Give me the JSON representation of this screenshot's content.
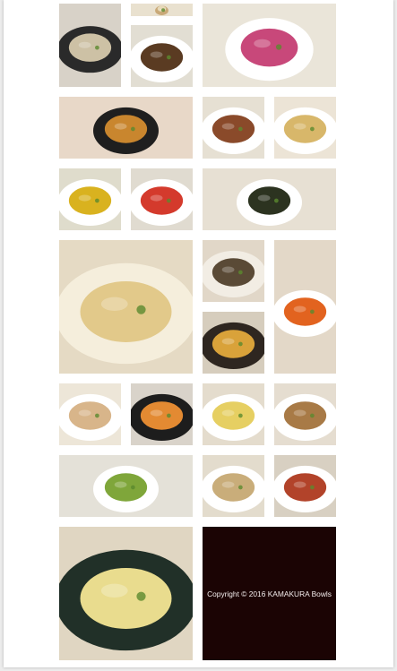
{
  "page": {
    "background": "#ececec",
    "panel": "#ffffff"
  },
  "gallery": {
    "tiles": [
      {
        "name": "potato-salad-photo",
        "bg": "#d8d2c8",
        "plate": "#2a2a2a",
        "food": "#cdc1a5"
      },
      {
        "name": "steamer-basket-photo",
        "bg": "#e9e1cf",
        "plate": "#c9a978",
        "food": "#e7d9b8"
      },
      {
        "name": "croquettes-beet-photo",
        "bg": "#eae5d9",
        "plate": "#ffffff",
        "food": "#c8487a"
      },
      {
        "name": "dipping-sauce-bowl-photo",
        "bg": "#e2ded3",
        "plate": "#ffffff",
        "food": "#5a3b22"
      },
      {
        "name": "mapo-tofu-photo",
        "bg": "#e8d8c8",
        "plate": "#1f1f1f",
        "food": "#c9862e"
      },
      {
        "name": "stuffed-pepper-photo",
        "bg": "#e6e0d3",
        "plate": "#ffffff",
        "food": "#8a4a2a"
      },
      {
        "name": "clear-soup-photo",
        "bg": "#ece4d6",
        "plate": "#ffffff",
        "food": "#d8b76a"
      },
      {
        "name": "three-sauces-photo",
        "bg": "#dfdccc",
        "plate": "#ffffff",
        "food": "#d9b21f"
      },
      {
        "name": "tomato-salad-photo",
        "bg": "#e0dbd0",
        "plate": "#ffffff",
        "food": "#d43a2c"
      },
      {
        "name": "hijiki-seaweed-photo",
        "bg": "#e7e0d3",
        "plate": "#ffffff",
        "food": "#2c3320"
      },
      {
        "name": "tofu-skin-roll-photo",
        "bg": "#e5dac4",
        "plate": "#f5eedc",
        "food": "#e2c98a"
      },
      {
        "name": "grilled-eggplant-photo",
        "bg": "#e1d7c8",
        "plate": "#f2ede4",
        "food": "#5a4a36"
      },
      {
        "name": "carrot-salad-photo",
        "bg": "#e3d8c8",
        "plate": "#ffffff",
        "food": "#e2631f"
      },
      {
        "name": "pumpkin-skewers-photo",
        "bg": "#d6cdbd",
        "plate": "#2e2620",
        "food": "#d9a23a"
      },
      {
        "name": "fried-tofu-sticks-photo",
        "bg": "#ede6d8",
        "plate": "#ffffff",
        "food": "#d8b58a"
      },
      {
        "name": "root-vegetables-photo",
        "bg": "#d9d3ca",
        "plate": "#1d1d1d",
        "food": "#e38a32"
      },
      {
        "name": "yuba-noodles-photo",
        "bg": "#e4dccd",
        "plate": "#ffffff",
        "food": "#e6cf62"
      },
      {
        "name": "sesame-fried-fish-photo",
        "bg": "#e5ddd0",
        "plate": "#ffffff",
        "food": "#a87a46"
      },
      {
        "name": "salmon-herb-sauce-photo",
        "bg": "#e4e1d8",
        "plate": "#ffffff",
        "food": "#7fa63a"
      },
      {
        "name": "tofu-greens-photo",
        "bg": "#e3dccd",
        "plate": "#ffffff",
        "food": "#c9ad7a"
      },
      {
        "name": "ratatouille-bowl-photo",
        "bg": "#d8d0c2",
        "plate": "#ffffff",
        "food": "#b2432a"
      },
      {
        "name": "grilled-chicken-egg-salad-photo",
        "bg": "#e0d6c2",
        "plate": "#213028",
        "food": "#e9dc8e"
      }
    ]
  },
  "footer": {
    "copyright": "Copyright © 2016 KAMAKURA Bowls",
    "bg": "#1b0404"
  }
}
